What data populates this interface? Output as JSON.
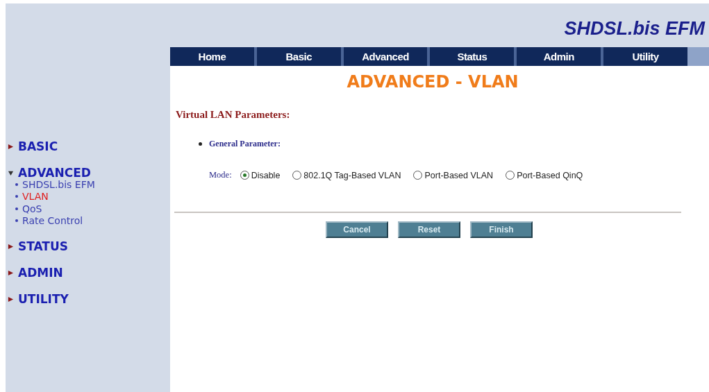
{
  "header": {
    "title": "SHDSL.bis EFM"
  },
  "tabs": [
    {
      "label": "Home"
    },
    {
      "label": "Basic"
    },
    {
      "label": "Advanced"
    },
    {
      "label": "Status"
    },
    {
      "label": "Admin"
    },
    {
      "label": "Utility"
    }
  ],
  "sidebar": {
    "items": [
      {
        "label": "BASIC",
        "expanded": false
      },
      {
        "label": "ADVANCED",
        "expanded": true,
        "children": [
          {
            "label": "SHDSL.bis EFM",
            "selected": false
          },
          {
            "label": "VLAN",
            "selected": true
          },
          {
            "label": "QoS",
            "selected": false
          },
          {
            "label": "Rate Control",
            "selected": false
          }
        ]
      },
      {
        "label": "STATUS",
        "expanded": false
      },
      {
        "label": "ADMIN",
        "expanded": false
      },
      {
        "label": "UTILITY",
        "expanded": false
      }
    ]
  },
  "page_title": "ADVANCED - VLAN",
  "section_title": "Virtual LAN Parameters:",
  "subsection": "General Parameter:",
  "mode": {
    "label": "Mode:",
    "options": [
      {
        "label": "Disable",
        "selected": true
      },
      {
        "label": "802.1Q Tag-Based VLAN",
        "selected": false
      },
      {
        "label": "Port-Based VLAN",
        "selected": false
      },
      {
        "label": "Port-Based QinQ",
        "selected": false
      }
    ]
  },
  "buttons": [
    "Cancel",
    "Reset",
    "Finish"
  ]
}
